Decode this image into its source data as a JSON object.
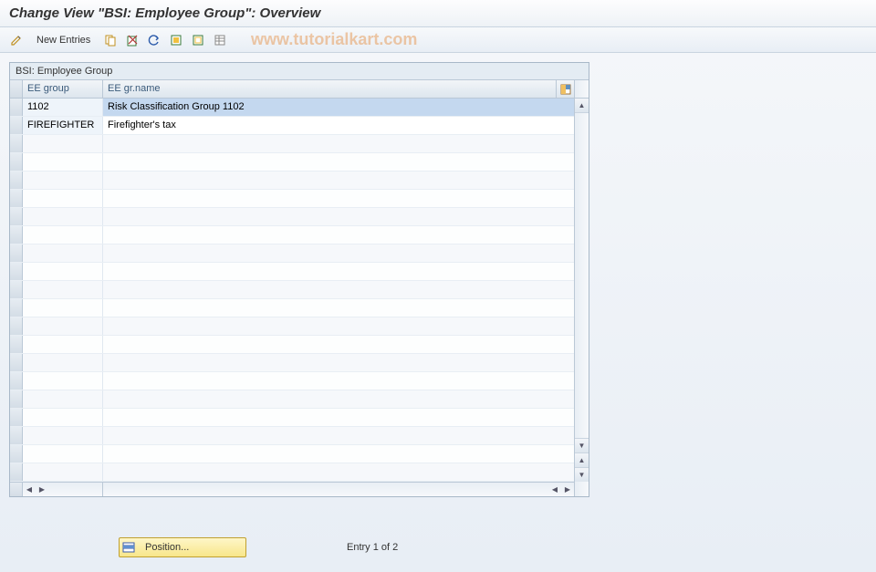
{
  "title": "Change View \"BSI: Employee Group\": Overview",
  "watermark": "www.tutorialkart.com",
  "toolbar": {
    "new_entries": "New Entries"
  },
  "panel": {
    "title": "BSI: Employee Group",
    "col1": "EE group",
    "col2": "EE gr.name"
  },
  "rows": [
    {
      "group": "1102",
      "name": "Risk Classification Group 1102",
      "selected": true
    },
    {
      "group": "FIREFIGHTER",
      "name": "Firefighter's tax",
      "selected": false
    }
  ],
  "position_btn": "Position...",
  "entry_status": "Entry 1 of 2"
}
